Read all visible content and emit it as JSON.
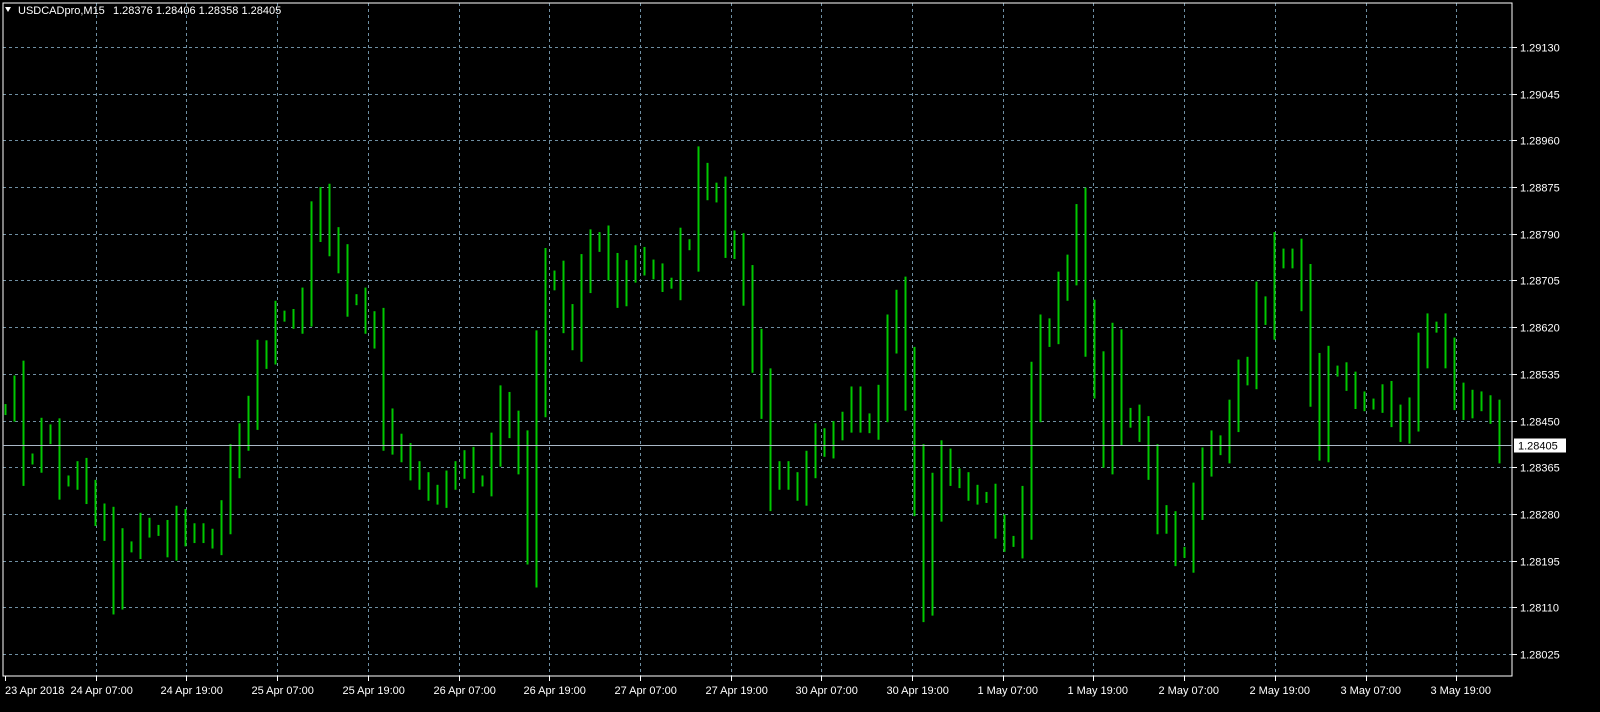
{
  "header": {
    "symbol_label": "USDCADpro,M15",
    "ohlc_label": "1.28376 1.28406 1.28358 1.28405"
  },
  "colors": {
    "background": "#000000",
    "grid": "#6f8fa3",
    "bars": "#00c800",
    "text": "#ffffff",
    "price_line": "#a9b7c6"
  },
  "chart_data": {
    "type": "bar",
    "title": "",
    "xlabel": "",
    "ylabel": "",
    "ylim": [
      1.27985,
      1.2921
    ],
    "grid": true,
    "current_price": "1.28405",
    "y_ticks": [
      "1.29130",
      "1.29045",
      "1.28960",
      "1.28875",
      "1.28790",
      "1.28705",
      "1.28620",
      "1.28535",
      "1.28450",
      "1.28365",
      "1.28280",
      "1.28195",
      "1.28110",
      "1.28025"
    ],
    "x_ticks": [
      "23 Apr 2018",
      "24 Apr 07:00",
      "24 Apr 19:00",
      "25 Apr 07:00",
      "25 Apr 19:00",
      "26 Apr 07:00",
      "26 Apr 19:00",
      "27 Apr 07:00",
      "27 Apr 19:00",
      "30 Apr 07:00",
      "30 Apr 19:00",
      "1 May 07:00",
      "1 May 19:00",
      "2 May 07:00",
      "2 May 19:00",
      "3 May 07:00",
      "3 May 19:00"
    ],
    "series": [
      {
        "close": [
          1.2847,
          1.2851,
          1.2838,
          1.2838,
          1.2843,
          1.2842,
          1.2834,
          1.2834,
          1.2836,
          1.2832,
          1.2828,
          1.2825,
          1.2814,
          1.2822,
          1.2822,
          1.2826,
          1.2825,
          1.2825,
          1.2822,
          1.2827,
          1.2824,
          1.2825,
          1.2824,
          1.2823,
          1.2828,
          1.2837,
          1.2842,
          1.2847,
          1.2856,
          1.2858,
          1.2864,
          1.2864,
          1.2863,
          1.2867,
          1.288,
          1.2885,
          1.2878,
          1.2874,
          1.2867,
          1.2867,
          1.2863,
          1.286,
          1.2845,
          1.2841,
          1.2839,
          1.2836,
          1.2834,
          1.2832,
          1.2831,
          1.2834,
          1.2836,
          1.2838,
          1.2834,
          1.2834,
          1.284,
          1.2848,
          1.2844,
          1.2838,
          1.2824,
          1.2852,
          1.287,
          1.2871,
          1.2864,
          1.286,
          1.2871,
          1.2877,
          1.2878,
          1.2873,
          1.2868,
          1.2872,
          1.2875,
          1.2873,
          1.2872,
          1.287,
          1.287,
          1.2877,
          1.2877,
          1.289,
          1.2887,
          1.2886,
          1.2878,
          1.2876,
          1.2869,
          1.2858,
          1.2849,
          1.2834,
          1.2836,
          1.2834,
          1.2832,
          1.2837,
          1.2842,
          1.284,
          1.2843,
          1.2845,
          1.2849,
          1.2845,
          1.2844,
          1.2849,
          1.286,
          1.2866,
          1.2852,
          1.2834,
          1.2815,
          1.283,
          1.2838,
          1.2835,
          1.2834,
          1.2832,
          1.2831,
          1.2831,
          1.2826,
          1.2823,
          1.2823,
          1.283,
          1.2849,
          1.286,
          1.2862,
          1.2869,
          1.2873,
          1.2881,
          1.2863,
          1.2853,
          1.2841,
          1.2857,
          1.2845,
          1.2846,
          1.2843,
          1.2837,
          1.2828,
          1.2826,
          1.2821,
          1.2821,
          1.283,
          1.2837,
          1.2841,
          1.284,
          1.2846,
          1.2853,
          1.2855,
          1.2866,
          1.2864,
          1.2875,
          1.2874,
          1.2875,
          1.2868,
          1.2853,
          1.2842,
          1.2854,
          1.2854,
          1.2852,
          1.2849,
          1.2848,
          1.2848,
          1.285,
          1.2846,
          1.2843,
          1.2847,
          1.2857,
          1.2862,
          1.2862,
          1.2857,
          1.285,
          1.2847,
          1.2849,
          1.2848,
          1.2846,
          1.284
        ]
      }
    ]
  }
}
